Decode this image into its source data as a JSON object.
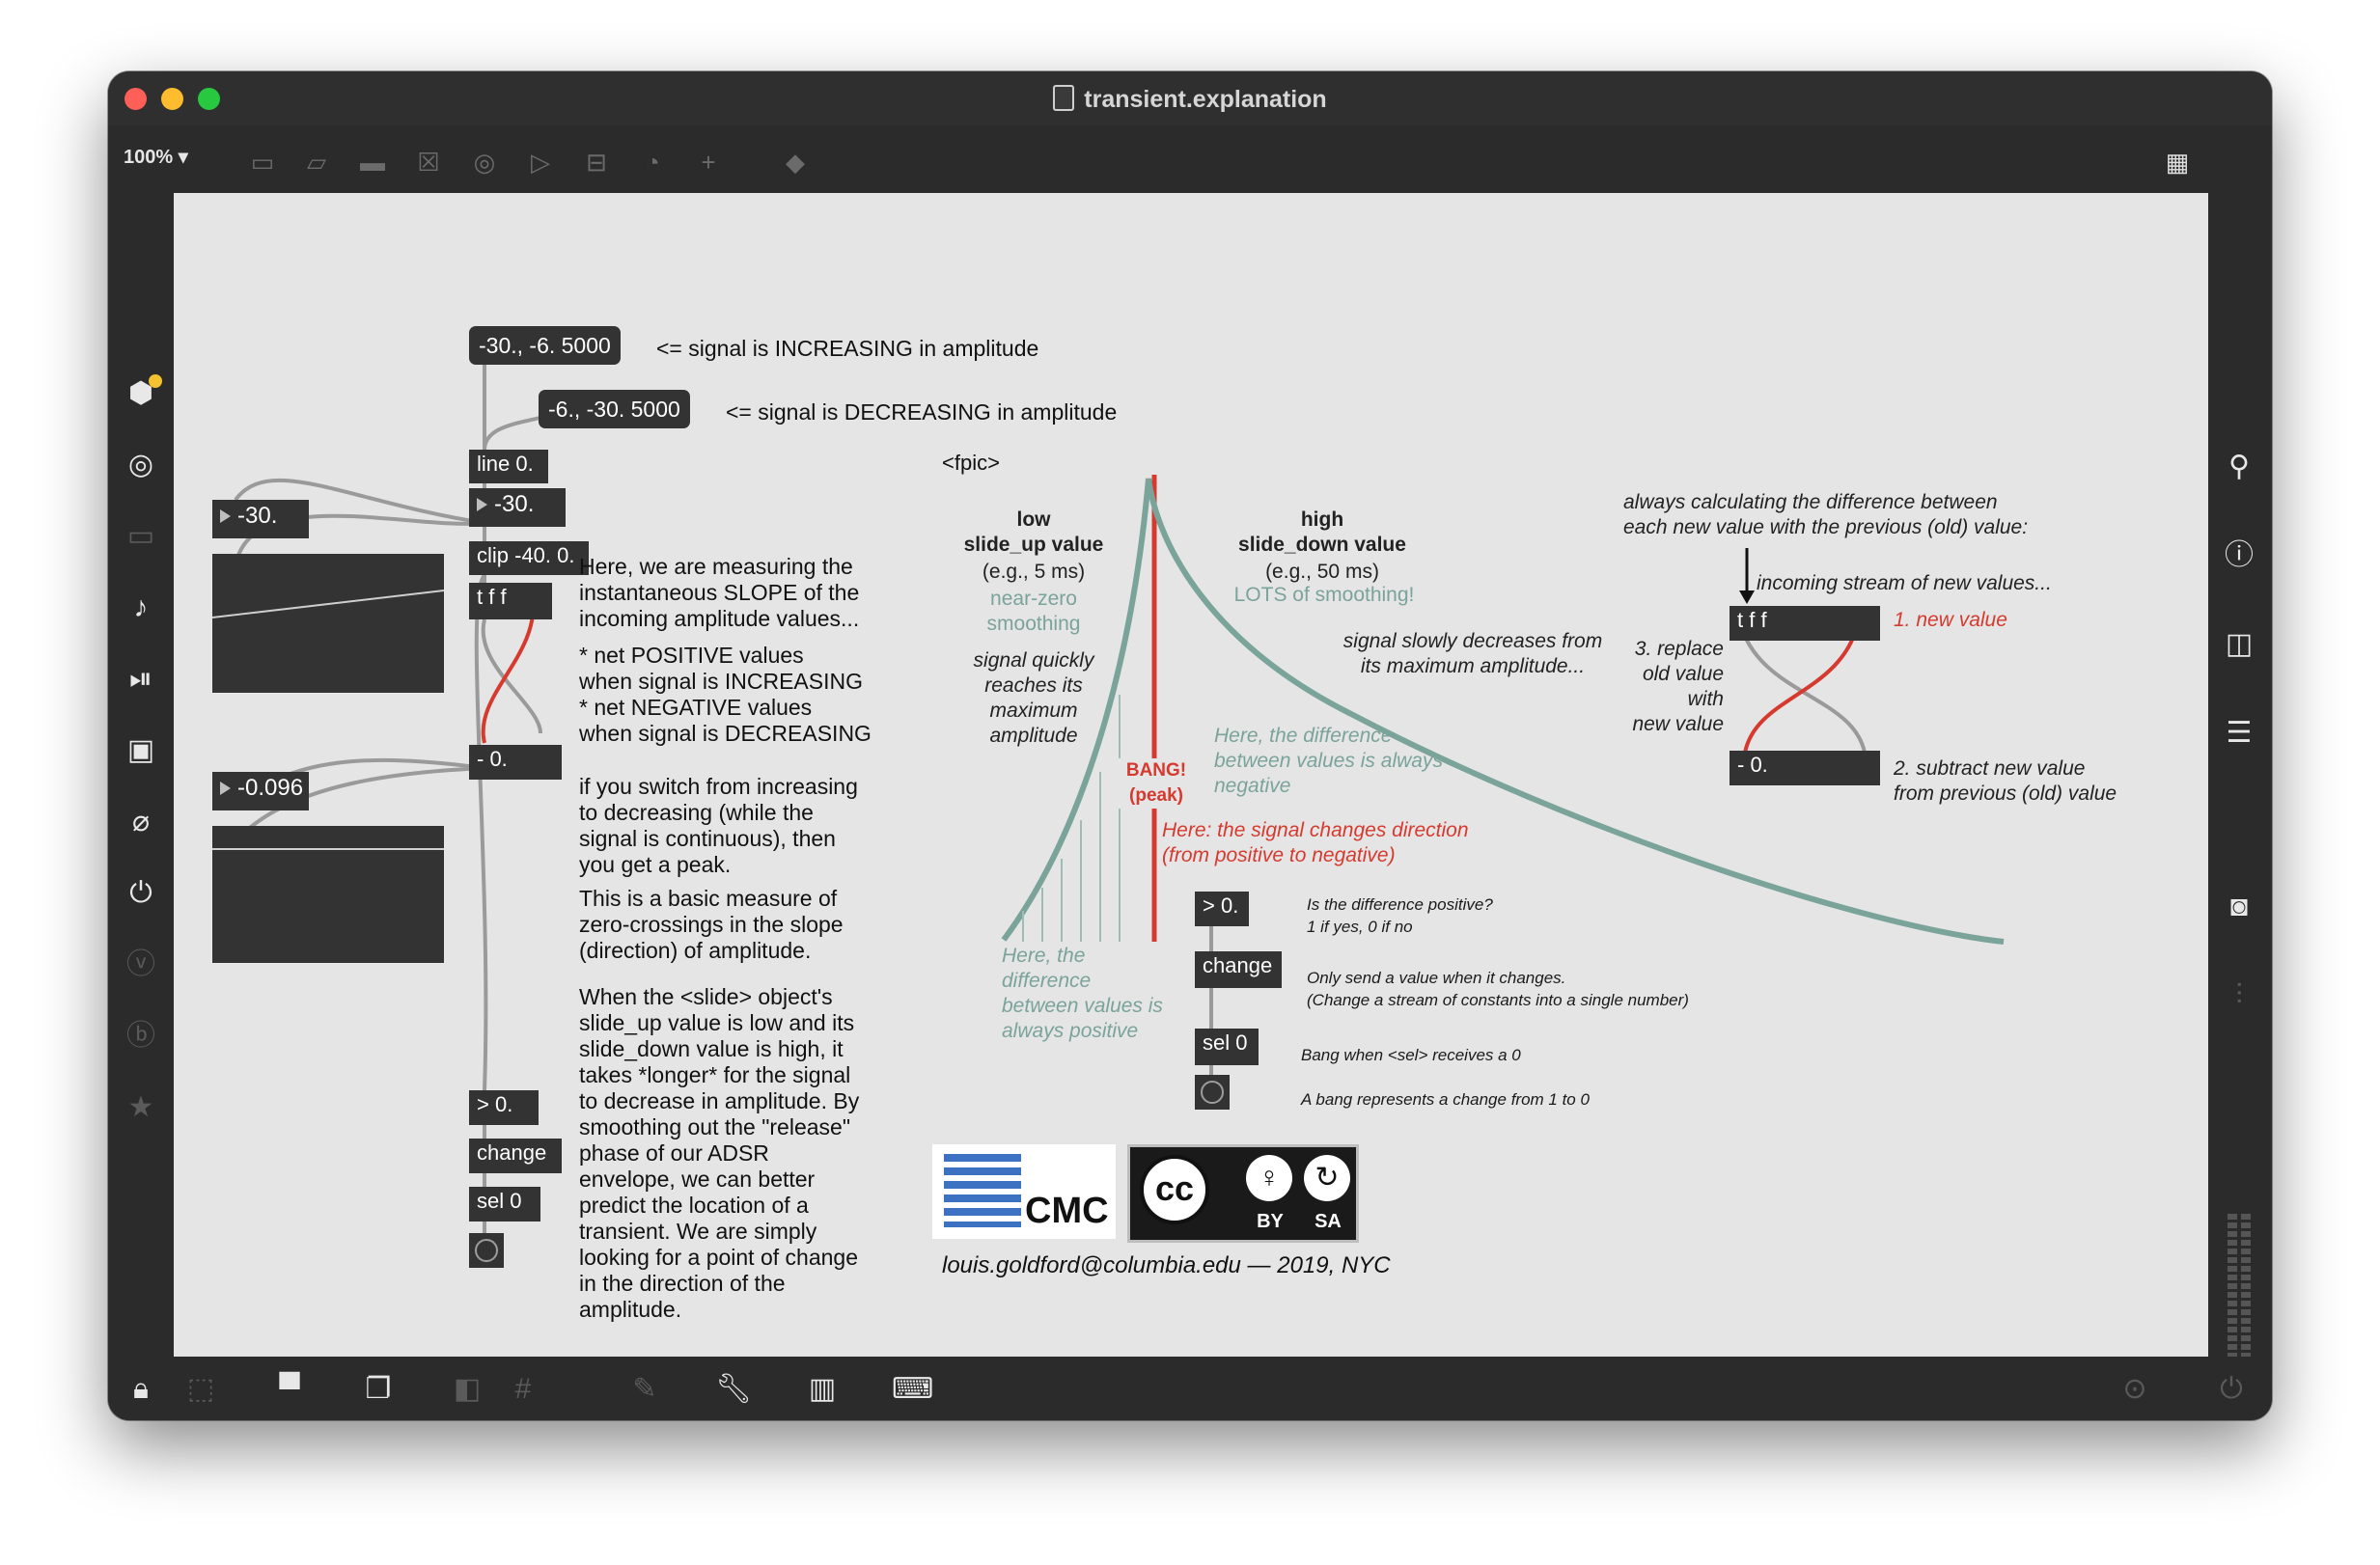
{
  "window": {
    "title": "transient.explanation"
  },
  "toolbar": {
    "zoom": "100%",
    "icons": [
      "object-icon",
      "message-icon",
      "comment-icon",
      "toggle-icon",
      "button-icon",
      "number-icon",
      "slider-icon",
      "dial-icon",
      "add-icon",
      "paint-bucket-icon",
      "grid-menu-icon"
    ]
  },
  "left_sidebar": {
    "icons": [
      "package-manager-icon",
      "circle-target-icon",
      "console-icon",
      "music-note-icon",
      "media-icon",
      "image-icon",
      "paperclip-icon",
      "plug-icon",
      "vizzie-icon",
      "beap-icon",
      "star-icon"
    ]
  },
  "right_sidebar": {
    "icons": [
      "search-icon",
      "info-icon",
      "reference-icon",
      "list-icon",
      "snapshot-icon",
      "mixer-icon"
    ]
  },
  "bottom_bar": {
    "icons": [
      "lock-icon",
      "edit-select-icon",
      "presentation-icon",
      "windows-icon",
      "grid-snap-icon",
      "grid-icon",
      "add-object-icon",
      "wrench-icon",
      "piano-icon",
      "keyboard-icon",
      "transport-icon",
      "power-icon"
    ]
  },
  "patch": {
    "msg_increasing": "-30., -6. 5000",
    "msg_increasing_comment": "<= signal is INCREASING in amplitude",
    "msg_decreasing": "-6., -30. 5000",
    "msg_decreasing_comment": "<= signal is DECREASING in amplitude",
    "obj_line": "line 0.",
    "num_signal": "-30.",
    "num_left_top": "-30.",
    "obj_clip": "clip -40. 0.",
    "obj_tff": "t f f",
    "obj_minus": "- 0.",
    "num_left_bottom": "-0.096",
    "obj_gt": "> 0.",
    "obj_change": "change",
    "obj_sel": "sel 0",
    "comment_slope": "Here, we are measuring the\ninstantaneous SLOPE of the\nincoming amplitude values...",
    "comment_positive": "* net POSITIVE values\nwhen signal is INCREASING\n* net NEGATIVE values\nwhen signal is DECREASING",
    "comment_switch": "if you switch from increasing\nto decreasing (while the\nsignal is continuous), then\nyou get a peak.",
    "comment_basic": "This is a basic measure of\nzero-crossings in the slope\n(direction) of amplitude.",
    "comment_slide": "When the <slide> object's\nslide_up value is low and its\nslide_down value is high, it\ntakes *longer* for the signal\nto decrease in amplitude. By\nsmoothing out the \"release\"\nphase of our ADSR\nenvelope, we can better\npredict the location of a\ntransient. We are simply\nlooking for a point of change\nin the direction of the\namplitude."
  },
  "diagram": {
    "fpic_label": "<fpic>",
    "low_title": "low\nslide_up value",
    "low_sub": "(e.g., 5 ms)",
    "low_green": "near-zero\nsmoothing",
    "low_quick": "signal quickly\nreaches its\nmaximum\namplitude",
    "high_title": "high\nslide_down value",
    "high_sub": "(e.g., 50 ms)",
    "high_green": "LOTS of smoothing!",
    "slowly": "signal slowly decreases from\nits maximum amplitude...",
    "diff_negative": "Here, the difference\nbetween values is always\nnegative",
    "diff_positive": "Here, the\ndifference\nbetween values is\nalways positive",
    "bang": "BANG!\n(peak)",
    "direction": "Here: the signal changes direction\n(from positive to negative)",
    "obj_gt": "> 0.",
    "obj_change": "change",
    "obj_sel": "sel 0",
    "note_gt": "Is the difference positive?\n     1 if yes, 0 if no",
    "note_change": "Only send a value when it changes.\n     (Change a stream of constants into a single number)",
    "note_sel": "Bang when <sel> receives a 0",
    "note_bang": "A bang represents a change from 1 to 0",
    "always_calc": "always calculating the difference between\neach new value with the previous (old) value:",
    "incoming": "incoming stream of new values...",
    "obj_tff": "t f f",
    "obj_minus": "- 0.",
    "new_value": "1. new value",
    "replace": "3. replace\nold value\nwith\nnew value",
    "subtract": "2. subtract new value\nfrom previous (old) value",
    "cmc_text": "CMC",
    "cc_text": "cc",
    "cc_by": "BY",
    "cc_sa": "SA",
    "credit": "louis.goldford@columbia.edu — 2019, NYC"
  },
  "colors": {
    "canvas": "#e5e5e5",
    "box": "#333333",
    "red": "#d63a2f",
    "green": "#7aa39a"
  }
}
